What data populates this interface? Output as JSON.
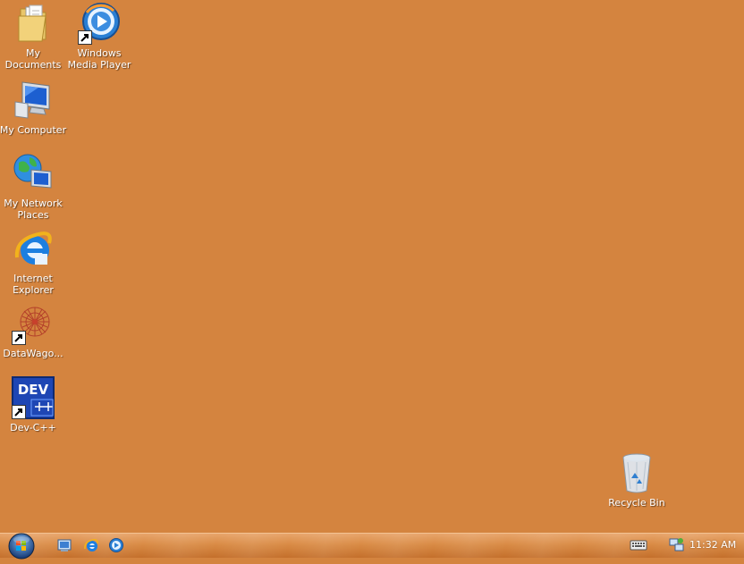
{
  "desktop": {
    "icons": [
      {
        "label": "My\nDocuments",
        "name": "my-documents"
      },
      {
        "label": "Windows\nMedia Player",
        "name": "windows-media-player"
      },
      {
        "label": "My Computer",
        "name": "my-computer"
      },
      {
        "label": "My Network\nPlaces",
        "name": "my-network-places"
      },
      {
        "label": "Internet\nExplorer",
        "name": "internet-explorer"
      },
      {
        "label": "DataWago...",
        "name": "datawagon"
      },
      {
        "label": "Dev-C++",
        "name": "dev-cpp"
      },
      {
        "label": "Recycle Bin",
        "name": "recycle-bin"
      }
    ],
    "dev_icon_text": "DEV",
    "background_color": "#d4843f"
  },
  "taskbar": {
    "quick_launch": [
      "show-desktop-icon",
      "internet-explorer-icon",
      "windows-media-player-icon"
    ],
    "tray_icons": [
      "keyboard-icon",
      "network-icon"
    ],
    "clock": "11:32 AM"
  }
}
